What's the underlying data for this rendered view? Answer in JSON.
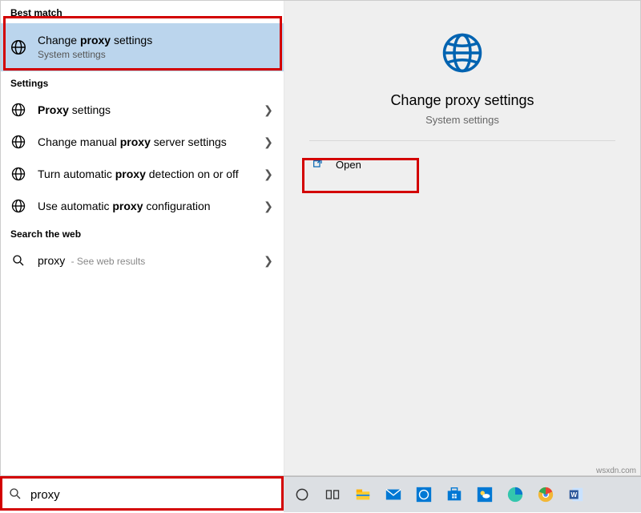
{
  "sections": {
    "best_match": "Best match",
    "settings": "Settings",
    "search_web": "Search the web"
  },
  "best_match": {
    "title_pre": "Change ",
    "title_bold": "proxy",
    "title_post": " settings",
    "subtitle": "System settings"
  },
  "settings_items": [
    {
      "pre": "",
      "bold": "Proxy",
      "post": " settings"
    },
    {
      "pre": "Change manual ",
      "bold": "proxy",
      "post": " server settings"
    },
    {
      "pre": "Turn automatic ",
      "bold": "proxy",
      "post": " detection on or off"
    },
    {
      "pre": "Use automatic ",
      "bold": "proxy",
      "post": " configuration"
    }
  ],
  "web_item": {
    "query": "proxy",
    "suffix": " - See web results"
  },
  "detail": {
    "title": "Change proxy settings",
    "subtitle": "System settings",
    "open": "Open"
  },
  "search": {
    "value": "proxy"
  },
  "taskbar": {
    "icons": [
      "cortana-icon",
      "task-view-icon",
      "file-explorer-icon",
      "mail-icon",
      "browser-icon",
      "store-icon",
      "weather-icon",
      "edge-icon",
      "chrome-icon",
      "word-icon"
    ]
  },
  "watermark": "wsxdn.com"
}
